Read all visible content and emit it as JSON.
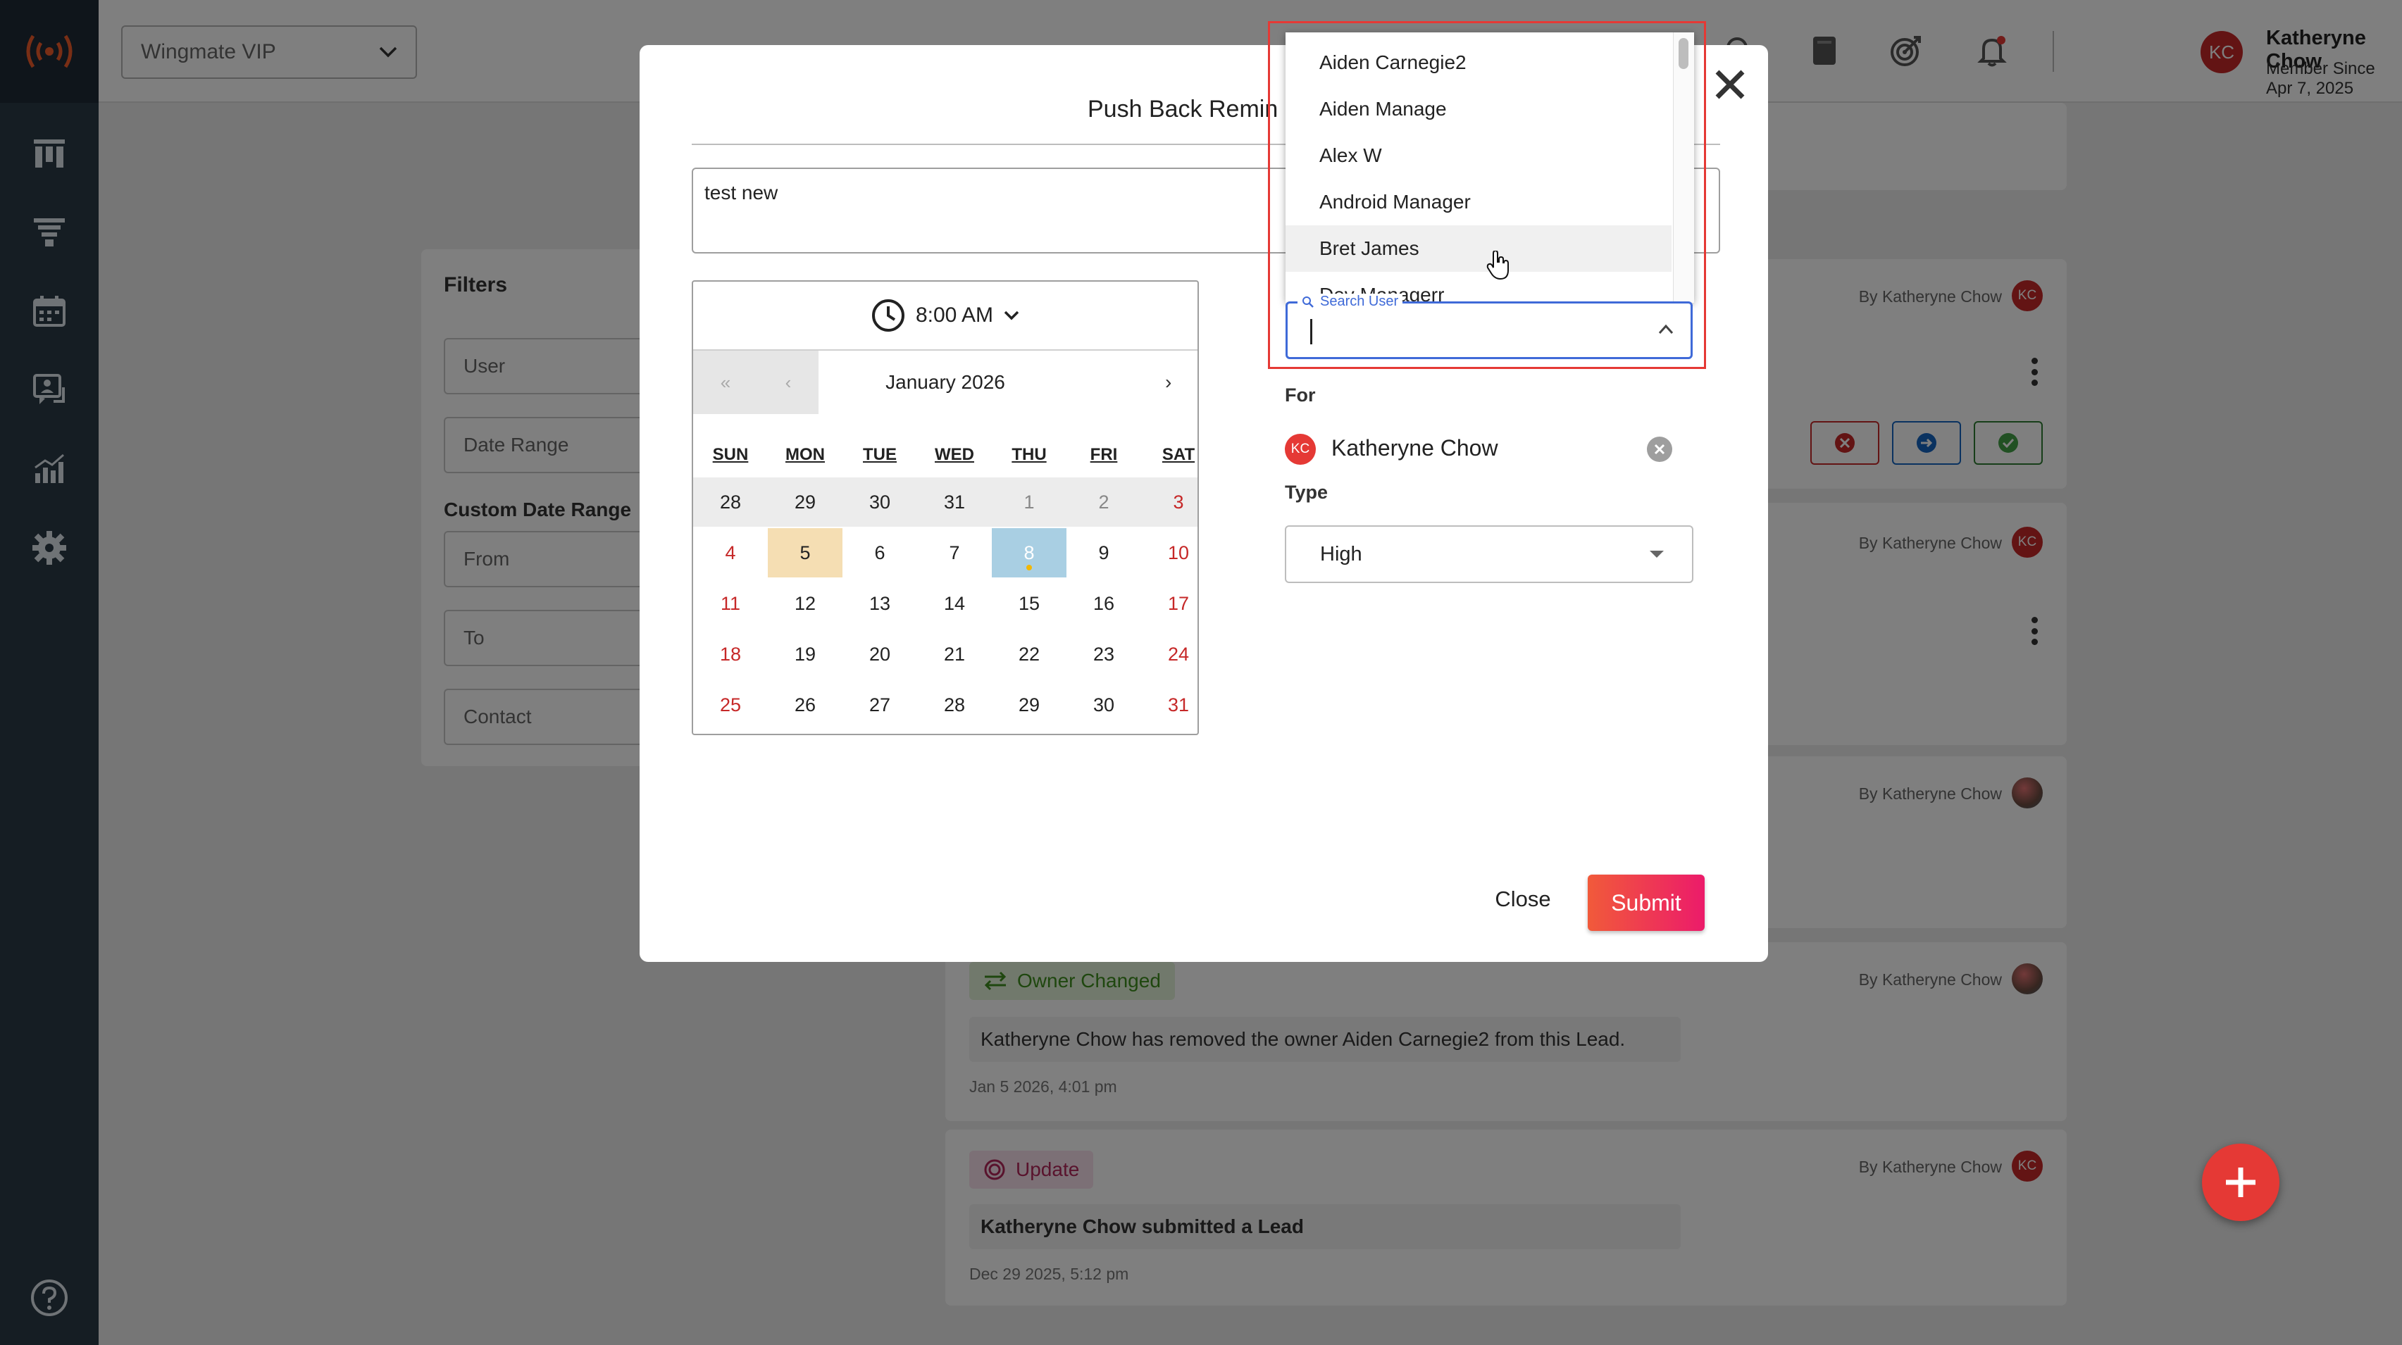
{
  "topbar": {
    "org_selector": "Wingmate VIP",
    "user_name": "Katheryne Chow",
    "user_since": "Member Since Apr 7, 2025",
    "user_initials": "KC"
  },
  "filters": {
    "title": "Filters",
    "user": "User",
    "date_range": "Date Range",
    "custom_label": "Custom Date Range",
    "from": "From",
    "to": "To",
    "contact": "Contact"
  },
  "feed": {
    "byline": "By Katheryne Chow",
    "initials": "KC",
    "owner_changed": {
      "badge": "Owner Changed",
      "text": "Katheryne Chow has removed the owner Aiden Carnegie2 from this Lead.",
      "date": "Jan 5 2026, 4:01 pm"
    },
    "update": {
      "badge": "Update",
      "text": "Katheryne Chow submitted a Lead",
      "date": "Dec 29 2025, 5:12 pm"
    }
  },
  "modal": {
    "title": "Push Back Remin",
    "note": "test new",
    "time": "8:00 AM",
    "month": "January 2026",
    "nav": {
      "first": "«",
      "prev": "‹",
      "next": "›",
      "last": "»"
    },
    "weekdays": [
      "SUN",
      "MON",
      "TUE",
      "WED",
      "THU",
      "FRI",
      "SAT"
    ],
    "weeks": [
      [
        "28",
        "29",
        "30",
        "31",
        "1",
        "2",
        "3"
      ],
      [
        "4",
        "5",
        "6",
        "7",
        "8",
        "9",
        "10"
      ],
      [
        "11",
        "12",
        "13",
        "14",
        "15",
        "16",
        "17"
      ],
      [
        "18",
        "19",
        "20",
        "21",
        "22",
        "23",
        "24"
      ],
      [
        "25",
        "26",
        "27",
        "28",
        "29",
        "30",
        "31"
      ]
    ],
    "for_label": "For",
    "for_name": "Katheryne Chow",
    "for_initials": "KC",
    "type_label": "Type",
    "type_value": "High",
    "close_label": "Close",
    "submit_label": "Submit"
  },
  "user_dropdown": {
    "options": [
      "Aiden Carnegie2",
      "Aiden Manage",
      "Alex W",
      "Android Manager",
      "Bret James",
      "Dev Managerr"
    ],
    "hovered_index": 4,
    "search_label": "Search User",
    "search_value": ""
  },
  "colors": {
    "accent_red": "#c62828",
    "submit_start": "#f15a3a",
    "submit_end": "#ec1b6a",
    "focus_blue": "#3f6ad8",
    "sidebar": "#2b3a47"
  }
}
